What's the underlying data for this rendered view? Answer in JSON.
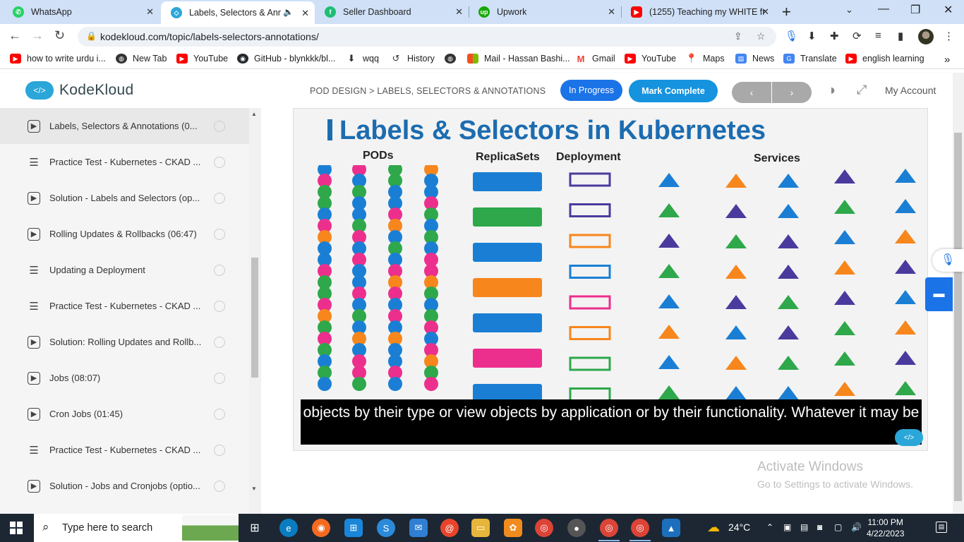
{
  "browser": {
    "tabs": [
      {
        "title": "WhatsApp",
        "color": "#25d366",
        "icon": "whatsapp-icon"
      },
      {
        "title": "Labels, Selectors & Anno",
        "color": "#2aa6d9",
        "icon": "kodekloud-icon"
      },
      {
        "title": "Seller Dashboard",
        "color": "#1dbf73",
        "icon": "fiverr-icon"
      },
      {
        "title": "Upwork",
        "color": "#14a800",
        "icon": "upwork-icon"
      },
      {
        "title": "(1255) Teaching my WHITE fr",
        "color": "#ff0000",
        "icon": "youtube-icon"
      }
    ],
    "url": "kodekloud.com/topic/labels-selectors-annotations/",
    "bookmarks": [
      {
        "label": "how to write urdu i...",
        "color": "#ff0000"
      },
      {
        "label": "New Tab",
        "color": "#333333"
      },
      {
        "label": "YouTube",
        "color": "#ff0000"
      },
      {
        "label": "GitHub - blynkkk/bl...",
        "color": "#24292e"
      },
      {
        "label": "wqq",
        "color": "#555555"
      },
      {
        "label": "History",
        "color": "#555555"
      },
      {
        "label": "",
        "color": "#333333"
      },
      {
        "label": "Mail - Hassan Bashi...",
        "color": "#f25022"
      },
      {
        "label": "Gmail",
        "color": "#ea4335"
      },
      {
        "label": "YouTube",
        "color": "#ff0000"
      },
      {
        "label": "Maps",
        "color": "#34a853"
      },
      {
        "label": "News",
        "color": "#4285f4"
      },
      {
        "label": "Translate",
        "color": "#4285f4"
      },
      {
        "label": "english learning",
        "color": "#ff0000"
      }
    ],
    "more": "»"
  },
  "header": {
    "logo": "KodeKloud",
    "breadcrumb": "POD DESIGN > LABELS, SELECTORS & ANNOTATIONS",
    "status": "In Progress",
    "mark_complete": "Mark Complete",
    "prev": "‹",
    "next": "›",
    "account": "My Account"
  },
  "sidebar": {
    "items": [
      {
        "label": "Labels, Selectors & Annotations (0...",
        "type": "video",
        "current": true
      },
      {
        "label": "Practice Test - Kubernetes - CKAD ...",
        "type": "lab"
      },
      {
        "label": "Solution - Labels and Selectors (op...",
        "type": "video"
      },
      {
        "label": "Rolling Updates & Rollbacks (06:47)",
        "type": "video"
      },
      {
        "label": "Updating a Deployment",
        "type": "lab"
      },
      {
        "label": "Practice Test - Kubernetes - CKAD ...",
        "type": "lab"
      },
      {
        "label": "Solution: Rolling Updates and Rollb...",
        "type": "video"
      },
      {
        "label": "Jobs (08:07)",
        "type": "video"
      },
      {
        "label": "Cron Jobs (01:45)",
        "type": "video"
      },
      {
        "label": "Practice Test - Kubernetes - CKAD ...",
        "type": "lab"
      },
      {
        "label": "Solution - Jobs and Cronjobs (optio...",
        "type": "video"
      }
    ]
  },
  "video": {
    "slide_title": "Labels & Selectors in Kubernetes",
    "columns": {
      "pods": "PODs",
      "replicasets": "ReplicaSets",
      "deployment": "Deployment",
      "services": "Services"
    },
    "caption": "objects by their type or view objects by application or by their functionality. Whatever it may be",
    "colors": {
      "blue": "#1a7fd4",
      "pink": "#ec2f8d",
      "green": "#2ea84a",
      "orange": "#f7861c",
      "purple": "#4b3a9e"
    }
  },
  "watermark": {
    "line1": "Activate Windows",
    "line2": "Go to Settings to activate Windows."
  },
  "taskbar": {
    "search_placeholder": "Type here to search",
    "temperature": "24°C",
    "time": "11:00 PM",
    "date": "4/22/2023"
  }
}
